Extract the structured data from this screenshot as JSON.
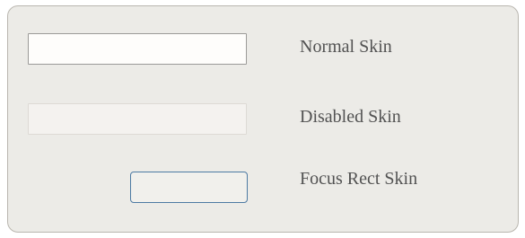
{
  "window": {
    "background_color": "#ecebe7",
    "border_color": "#b9b6af"
  },
  "rows": [
    {
      "label": "Normal Skin",
      "state": "normal",
      "value": ""
    },
    {
      "label": "Disabled Skin",
      "state": "disabled",
      "value": ""
    },
    {
      "label": "Focus Rect Skin",
      "state": "focused",
      "value": "",
      "focus_color": "#4d7aa3"
    }
  ]
}
